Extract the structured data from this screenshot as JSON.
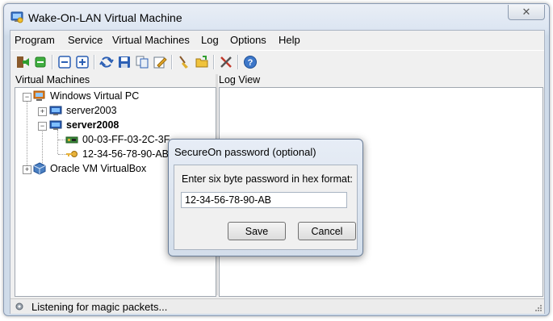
{
  "window": {
    "title": "Wake-On-LAN Virtual Machine",
    "close_glyph": "✕"
  },
  "menu": {
    "items": [
      "Program",
      "Service",
      "Virtual Machines",
      "Log",
      "Options",
      "Help"
    ]
  },
  "toolbar": {
    "icons": [
      "exit-icon",
      "start-icon",
      "collapse-icon",
      "expand-icon",
      "refresh-icon",
      "save-icon",
      "copy-icon",
      "edit-icon",
      "clear-icon",
      "open-folder-icon",
      "tools-icon",
      "help-icon"
    ]
  },
  "panels": {
    "tree_label": "Virtual Machines",
    "log_label": "Log View"
  },
  "tree": {
    "nodes": [
      {
        "label": "Windows Virtual PC",
        "expander": "−"
      },
      {
        "label": "server2003",
        "expander": "+"
      },
      {
        "label": "server2008",
        "expander": "−"
      },
      {
        "label": "00-03-FF-03-2C-3F"
      },
      {
        "label": "12-34-56-78-90-AB"
      },
      {
        "label": "Oracle VM VirtualBox",
        "expander": "+"
      }
    ]
  },
  "status": {
    "text": "Listening for magic packets..."
  },
  "dialog": {
    "title": "SecureOn password (optional)",
    "label": "Enter six byte password in hex format:",
    "value": "12-34-56-78-90-AB",
    "save_label": "Save",
    "cancel_label": "Cancel"
  }
}
